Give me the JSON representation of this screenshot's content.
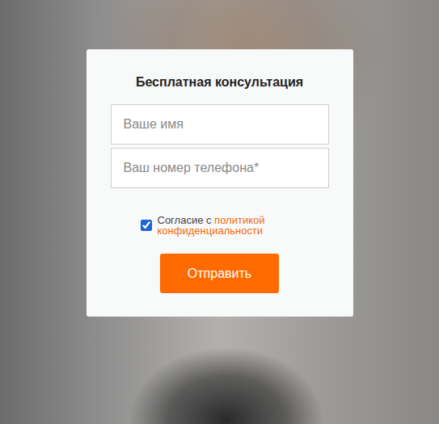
{
  "form": {
    "title": "Бесплатная консультация",
    "fields": [
      {
        "placeholder": "Ваше имя"
      },
      {
        "placeholder": "Ваш номер телефона*"
      }
    ],
    "consent": {
      "checked": true,
      "text": "Согласие с ",
      "link": "политикой конфиденциальности"
    },
    "submit": "Отправить"
  }
}
